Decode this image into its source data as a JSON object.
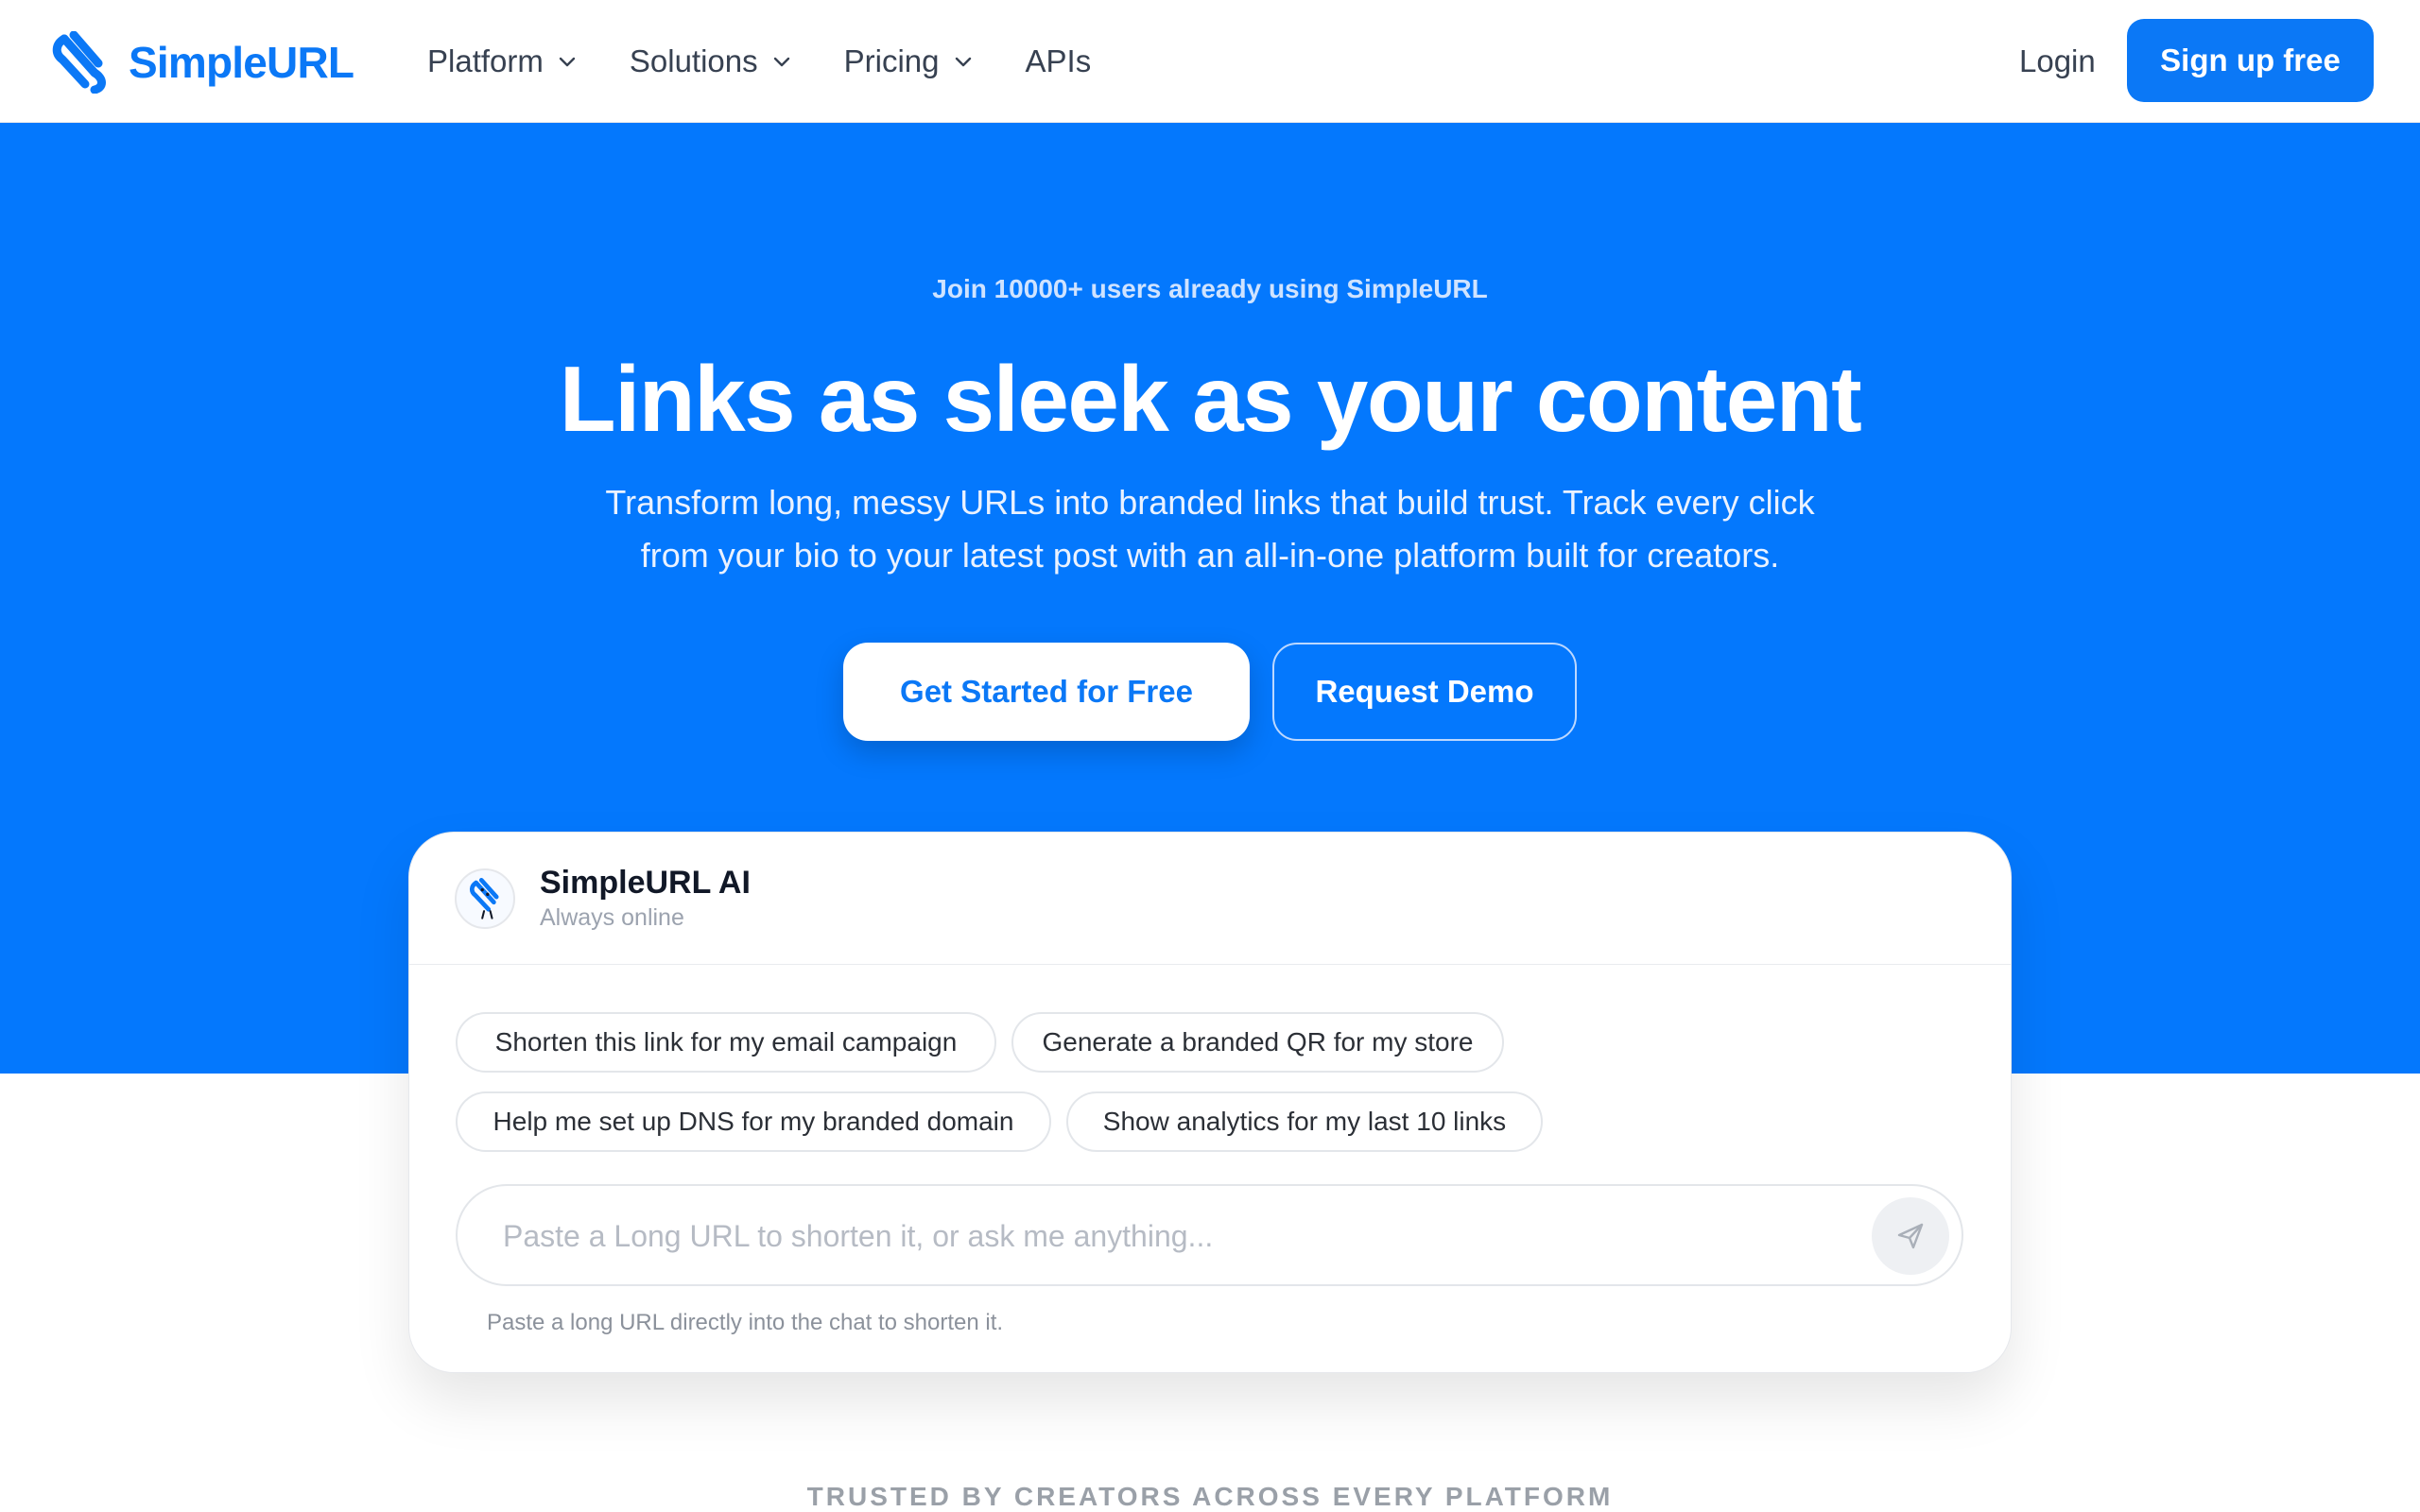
{
  "brand": {
    "name": "SimpleURL",
    "logo_icon": "simpleurl-logo-icon",
    "color": "#0b78f6"
  },
  "nav": {
    "items": [
      {
        "label": "Platform",
        "has_dropdown": true
      },
      {
        "label": "Solutions",
        "has_dropdown": true
      },
      {
        "label": "Pricing",
        "has_dropdown": true
      },
      {
        "label": "APIs",
        "has_dropdown": false
      }
    ],
    "login_label": "Login",
    "signup_label": "Sign up free"
  },
  "hero": {
    "eyebrow": "Join 10000+ users already using SimpleURL",
    "headline": "Links as sleek as your content",
    "subtitle": "Transform long, messy URLs into branded links that build trust. Track every click from your bio to your latest post with an all-in-one platform built for creators.",
    "primary_cta": "Get Started for Free",
    "secondary_cta": "Request Demo",
    "background_color": "#0478fd"
  },
  "chat": {
    "name": "SimpleURL AI",
    "status": "Always online",
    "avatar_icon": "bot-mascot-icon",
    "suggestions": [
      "Shorten this link for my email campaign",
      "Generate a branded QR for my store",
      "Help me set up DNS for my branded domain",
      "Show analytics for my last 10 links"
    ],
    "input_placeholder": "Paste a Long URL to shorten it, or ask me anything...",
    "input_value": "",
    "send_icon": "send-icon",
    "hint": "Paste a long URL directly into the chat to shorten it."
  },
  "trusted_label": "TRUSTED BY CREATORS ACROSS EVERY PLATFORM"
}
